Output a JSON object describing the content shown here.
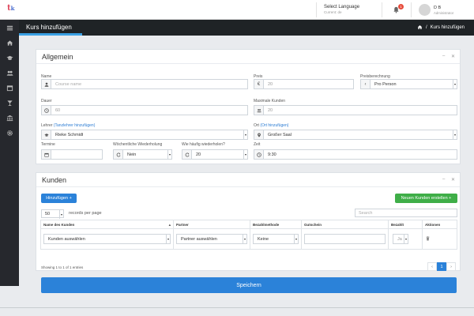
{
  "topbar": {
    "language_label": "Select Language",
    "language_current": "Current: de",
    "notification_count": "1",
    "user_name": "D B",
    "user_role": "Administrator"
  },
  "page": {
    "title": "Kurs hinzufügen",
    "breadcrumb": "Kurs hinzufügen"
  },
  "allgemein": {
    "title": "Allgemein",
    "name_label": "Name",
    "name_placeholder": "Course name",
    "preis_label": "Preis",
    "preis_value": "20",
    "preisberechnung_label": "Preisberechnung",
    "preisberechnung_value": "Pro Person",
    "dauer_label": "Dauer",
    "dauer_value": "60",
    "max_kunden_label": "Maximale Kunden",
    "max_kunden_value": "20",
    "lehrer_label": "Lehrer",
    "lehrer_link": "(Tanzlehrer hinzufügen)",
    "lehrer_value": "Rieke Schmidt",
    "ort_label": "Ort",
    "ort_link": "(Ort hinzufügen)",
    "ort_value": "Großer Saal",
    "termine_label": "Termine",
    "woechentlich_label": "Wöchentliche Wiederholung",
    "woechentlich_value": "Nein",
    "haeufig_label": "Wie häufig wiederholen?",
    "haeufig_value": "20",
    "zeit_label": "Zeit",
    "zeit_value": "9:30"
  },
  "kunden": {
    "title": "Kunden",
    "add_button": "Hinzufügen",
    "new_button": "Neuen Kunden erstellen",
    "page_size": "50",
    "records_label": "records per page",
    "search_placeholder": "Search",
    "columns": [
      "Name des Kunden",
      "Partner",
      "Bezahlmethode",
      "Gutschein",
      "Bezahlt",
      "Aktionen"
    ],
    "row": {
      "kunde": "Kunden auswählen",
      "partner": "Partner auswählen",
      "methode": "Keine",
      "bezahlt": "Ja"
    },
    "info": "Showing 1 to 1 of 1 entries",
    "current_page": "1"
  },
  "save_button": "Speichern",
  "colors": {
    "accent": "#2b82d9",
    "green": "#3fae48",
    "sidebar": "#26282d",
    "titlebar": "#1f2326"
  }
}
